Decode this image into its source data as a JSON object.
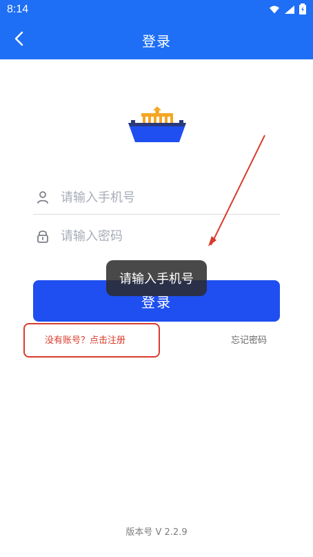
{
  "status_bar": {
    "time": "8:14",
    "icons": [
      "wifi-icon",
      "signal-icon",
      "battery-icon"
    ]
  },
  "header": {
    "title": "登录",
    "back_icon": "back-arrow-icon"
  },
  "logo": {
    "icon": "bank-logo-icon"
  },
  "form": {
    "phone_placeholder": "请输入手机号",
    "password_placeholder": "请输入密码",
    "phone_icon": "user-icon",
    "password_icon": "lock-icon"
  },
  "login_button": {
    "label": "登录"
  },
  "toast": {
    "text": "请输入手机号"
  },
  "links": {
    "register": "没有账号？点击注册",
    "forgot": "忘记密码"
  },
  "version": {
    "text": "版本号 V 2.2.9"
  },
  "colors": {
    "header": "#1e6ff5",
    "button": "#1f4ff0",
    "annotation": "#d93a2b"
  }
}
